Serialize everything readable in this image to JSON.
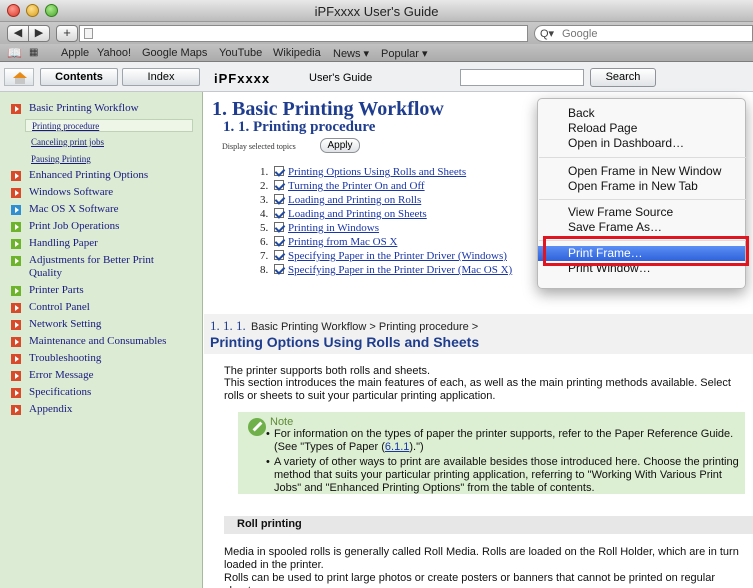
{
  "window": {
    "title": "iPFxxxx User's Guide"
  },
  "toolbar": {
    "back_glyph": "◀",
    "forward_glyph": "▶",
    "add_glyph": "+",
    "search_glyph": "Q▾",
    "search_placeholder": "Google"
  },
  "bookmarks": {
    "items": [
      "Apple",
      "Yahoo!",
      "Google Maps",
      "YouTube",
      "Wikipedia",
      "News ▾",
      "Popular ▾"
    ]
  },
  "help": {
    "tabs": [
      "Contents",
      "Index"
    ],
    "brand": "iPFxxxx",
    "guide": "User's Guide",
    "search_button": "Search"
  },
  "sidebar": {
    "items": [
      "Basic Printing Workflow",
      "Enhanced Printing Options",
      "Windows Software",
      "Mac OS X Software",
      "Print Job Operations",
      "Handling Paper",
      "Adjustments for Better Print",
      "Quality",
      "Printer Parts",
      "Control Panel",
      "Network Setting",
      "Maintenance and Consumables",
      "Troubleshooting",
      "Error Message",
      "Specifications",
      "Appendix"
    ],
    "subitems": [
      "Printing procedure",
      "Canceling print jobs",
      "Pausing Printing"
    ]
  },
  "main": {
    "h1": "1. Basic Printing Workflow",
    "h2": "1. 1. Printing procedure",
    "display_label": "Display selected topics",
    "apply_button": "Apply",
    "topics": [
      {
        "num": "1.",
        "label": "Printing Options Using Rolls and Sheets"
      },
      {
        "num": "2.",
        "label": "Turning the Printer On and Off"
      },
      {
        "num": "3.",
        "label": "Loading and Printing on Rolls"
      },
      {
        "num": "4.",
        "label": "Loading and Printing on Sheets"
      },
      {
        "num": "5.",
        "label": "Printing in Windows"
      },
      {
        "num": "6.",
        "label": "Printing from Mac OS X"
      },
      {
        "num": "7.",
        "label": "Specifying Paper in the Printer Driver (Windows)"
      },
      {
        "num": "8.",
        "label": "Specifying Paper in the Printer Driver (Mac OS X)"
      }
    ],
    "section_num": "1. 1. 1.",
    "section_crumb": "Basic Printing Workflow > Printing procedure >",
    "section_title": "Printing Options Using Rolls and Sheets",
    "intro_1": "The printer supports both rolls and sheets.",
    "intro_2": "This section introduces the main features of each, as well as the main printing methods available. Select rolls or sheets to suit your particular printing application.",
    "note_title": "Note",
    "note_1a": "For information on the types of paper the printer supports, refer to the Paper Reference Guide.  (See \"Types of Paper (",
    "note_1ref": "6.1.1",
    "note_1b": ").\")",
    "note_2": "A variety of other ways to print are available besides those introduced here. Choose the printing method that suits your particular printing application, referring to \"Working With Various Print Jobs\" and \"Enhanced Printing Options\" from the table of contents.",
    "roll_title": "Roll printing",
    "roll_1": "Media in spooled rolls is generally called Roll Media. Rolls are loaded on the Roll Holder, which are in turn loaded in the printer.",
    "roll_2": "Rolls can be used to print large photos or create posters or banners that cannot be printed on regular sheets."
  },
  "context_menu": {
    "items": [
      "Back",
      "Reload Page",
      "Open in Dashboard…",
      "Open Frame in New Window",
      "Open Frame in New Tab",
      "View Frame Source",
      "Save Frame As…",
      "Print Frame…",
      "Print Window…"
    ],
    "highlighted": "Print Frame…"
  },
  "colors": {
    "accent_blue": "#1f3d8f",
    "menu_highlight": "#3a6ee4",
    "annotation_red": "#e01520",
    "sidebar_bg": "#dcebd3"
  }
}
